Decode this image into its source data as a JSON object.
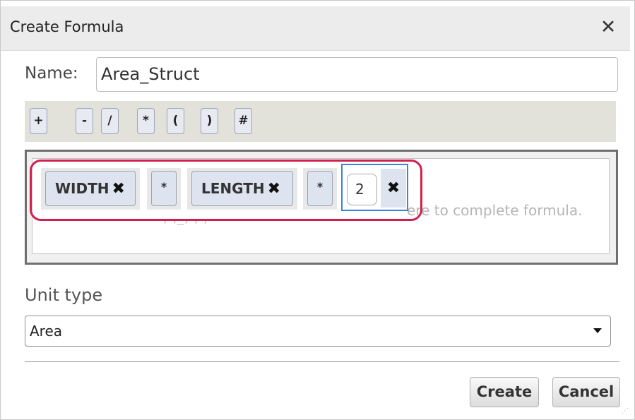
{
  "dialog": {
    "title": "Create Formula",
    "close_glyph": "✕"
  },
  "name": {
    "label": "Name:",
    "value": "Area_Struct"
  },
  "operators": [
    "+",
    "-",
    "/",
    "*",
    "(",
    ")",
    "#"
  ],
  "formula": {
    "tokens": [
      {
        "type": "variable",
        "label": "WIDTH",
        "remove": "✖"
      },
      {
        "type": "operator",
        "label": "*"
      },
      {
        "type": "variable",
        "label": "LENGTH",
        "remove": "✖"
      },
      {
        "type": "operator",
        "label": "*"
      },
      {
        "type": "number",
        "value": "2",
        "remove": "✖"
      }
    ],
    "hint_text": "ere to complete formula."
  },
  "unit_type": {
    "label": "Unit type",
    "selected": "Area"
  },
  "buttons": {
    "create": "Create",
    "cancel": "Cancel"
  },
  "colors": {
    "highlight": "#d2204e",
    "focus": "#3a83d7",
    "chip": "#dde4ef"
  }
}
